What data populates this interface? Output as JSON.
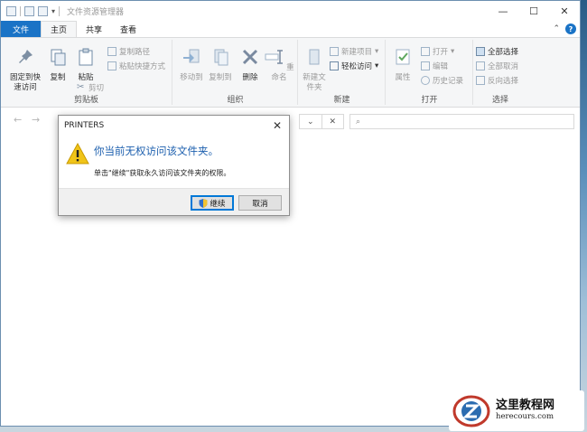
{
  "titlebar": {
    "title": "文件资源管理器",
    "minimize": "—",
    "maximize": "☐",
    "close": "✕"
  },
  "tabs": [
    "文件",
    "主页",
    "共享",
    "查看"
  ],
  "ribbon": {
    "clipboard": {
      "label": "剪贴板",
      "pin": "固定到快速访问",
      "copy": "复制",
      "paste": "粘贴",
      "copy_path": "复制路径",
      "paste_shortcut": "粘贴快捷方式",
      "cut": "剪切"
    },
    "organize": {
      "label": "组织",
      "move_to": "移动到",
      "copy_to": "复制到",
      "delete": "删除",
      "rename": "重命名"
    },
    "new": {
      "label": "新建",
      "new_folder": "新建文件夹",
      "new_item": "新建项目",
      "easy_access": "轻松访问"
    },
    "open": {
      "label": "打开",
      "properties": "属性",
      "open": "打开",
      "edit": "编辑",
      "history": "历史记录"
    },
    "select": {
      "label": "选择",
      "select_all": "全部选择",
      "select_none": "全部取消",
      "invert": "反向选择"
    }
  },
  "dialog": {
    "title": "PRINTERS",
    "message": "你当前无权访问该文件夹。",
    "detail": "单击\"继续\"获取永久访问该文件夹的权限。",
    "continue_label": "继续",
    "cancel_label": "取消"
  },
  "watermark": {
    "name": "这里教程网",
    "url": "herecours.com"
  },
  "colors": {
    "accent": "#1a73c6",
    "dialog_text": "#1c5fae",
    "warning": "#f0c419"
  }
}
